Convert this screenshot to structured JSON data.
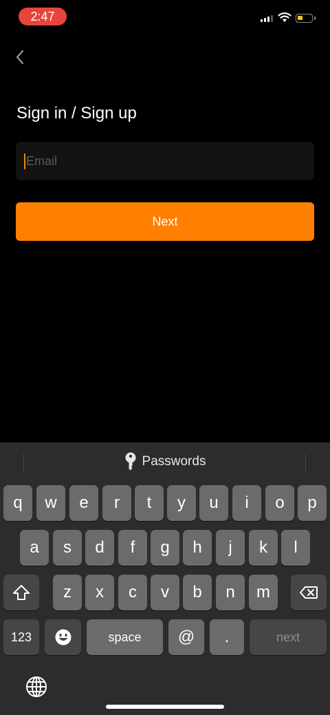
{
  "status_bar": {
    "time": "2:47",
    "battery_color": "#f5c518",
    "icons": [
      "cellular-signal-icon",
      "wifi-icon",
      "battery-icon"
    ]
  },
  "header": {
    "back_icon": "chevron-left-icon",
    "title": "Sign in / Sign up"
  },
  "form": {
    "email": {
      "placeholder": "Email",
      "value": ""
    },
    "next_label": "Next",
    "accent_color": "#ff8000"
  },
  "keyboard": {
    "passwords_label": "Passwords",
    "row1": [
      "q",
      "w",
      "e",
      "r",
      "t",
      "y",
      "u",
      "i",
      "o",
      "p"
    ],
    "row2": [
      "a",
      "s",
      "d",
      "f",
      "g",
      "h",
      "j",
      "k",
      "l"
    ],
    "row3": [
      "z",
      "x",
      "c",
      "v",
      "b",
      "n",
      "m"
    ],
    "numbers_label": "123",
    "space_label": "space",
    "at_label": "@",
    "dot_label": ".",
    "return_label": "next",
    "icons": [
      "key-icon",
      "shift-icon",
      "delete-icon",
      "emoji-icon",
      "globe-icon"
    ]
  }
}
